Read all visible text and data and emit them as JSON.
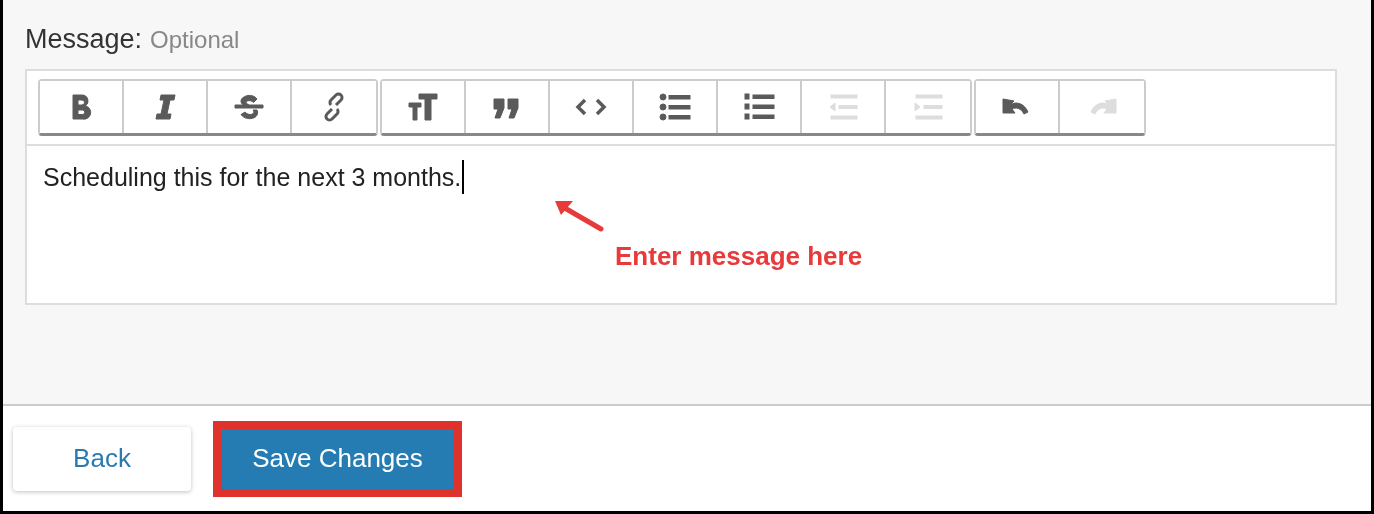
{
  "message_label": {
    "title": "Message:",
    "hint": "Optional"
  },
  "toolbar": {
    "groups": [
      {
        "buttons": [
          {
            "kind": "bold",
            "disabled": false
          },
          {
            "kind": "italic",
            "disabled": false
          },
          {
            "kind": "strike",
            "disabled": false
          },
          {
            "kind": "link",
            "disabled": false
          }
        ]
      },
      {
        "buttons": [
          {
            "kind": "heading",
            "disabled": false
          },
          {
            "kind": "quote",
            "disabled": false
          },
          {
            "kind": "code",
            "disabled": false
          },
          {
            "kind": "bullets",
            "disabled": false
          },
          {
            "kind": "numbers",
            "disabled": false
          },
          {
            "kind": "outdent",
            "disabled": true
          },
          {
            "kind": "indent",
            "disabled": true
          }
        ]
      },
      {
        "buttons": [
          {
            "kind": "undo",
            "disabled": false
          },
          {
            "kind": "redo",
            "disabled": true
          }
        ]
      }
    ]
  },
  "editor": {
    "value": "Scheduling this for the next 3 months."
  },
  "callout": "Enter message here",
  "buttons": [
    {
      "label": "Back",
      "kind": "secondary",
      "highlighted": false
    },
    {
      "label": "Save Changes",
      "kind": "primary",
      "highlighted": true
    }
  ]
}
